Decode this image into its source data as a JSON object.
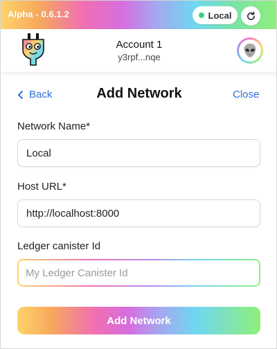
{
  "banner": {
    "version": "Alpha - 0.6.1.2",
    "network_label": "Local",
    "network_status_color": "#3ecf8e",
    "refresh_icon": "refresh-icon"
  },
  "account": {
    "name": "Account 1",
    "id_short": "y3rpf...nqe",
    "avatar_icon": "alien-emoji",
    "logo_icon": "plug-logo"
  },
  "nav": {
    "back_label": "Back",
    "title": "Add Network",
    "close_label": "Close"
  },
  "form": {
    "network_name_label": "Network Name*",
    "network_name_value": "Local",
    "host_url_label": "Host URL*",
    "host_url_value": "http://localhost:8000",
    "ledger_label": "Ledger canister Id",
    "ledger_placeholder": "My Ledger Canister Id",
    "ledger_value": ""
  },
  "actions": {
    "submit_label": "Add Network"
  },
  "colors": {
    "link": "#2f6fd6",
    "gradient": [
      "#ffd36a",
      "#f06fb3",
      "#b38cf0",
      "#6fd8f0",
      "#8fef7a"
    ]
  }
}
